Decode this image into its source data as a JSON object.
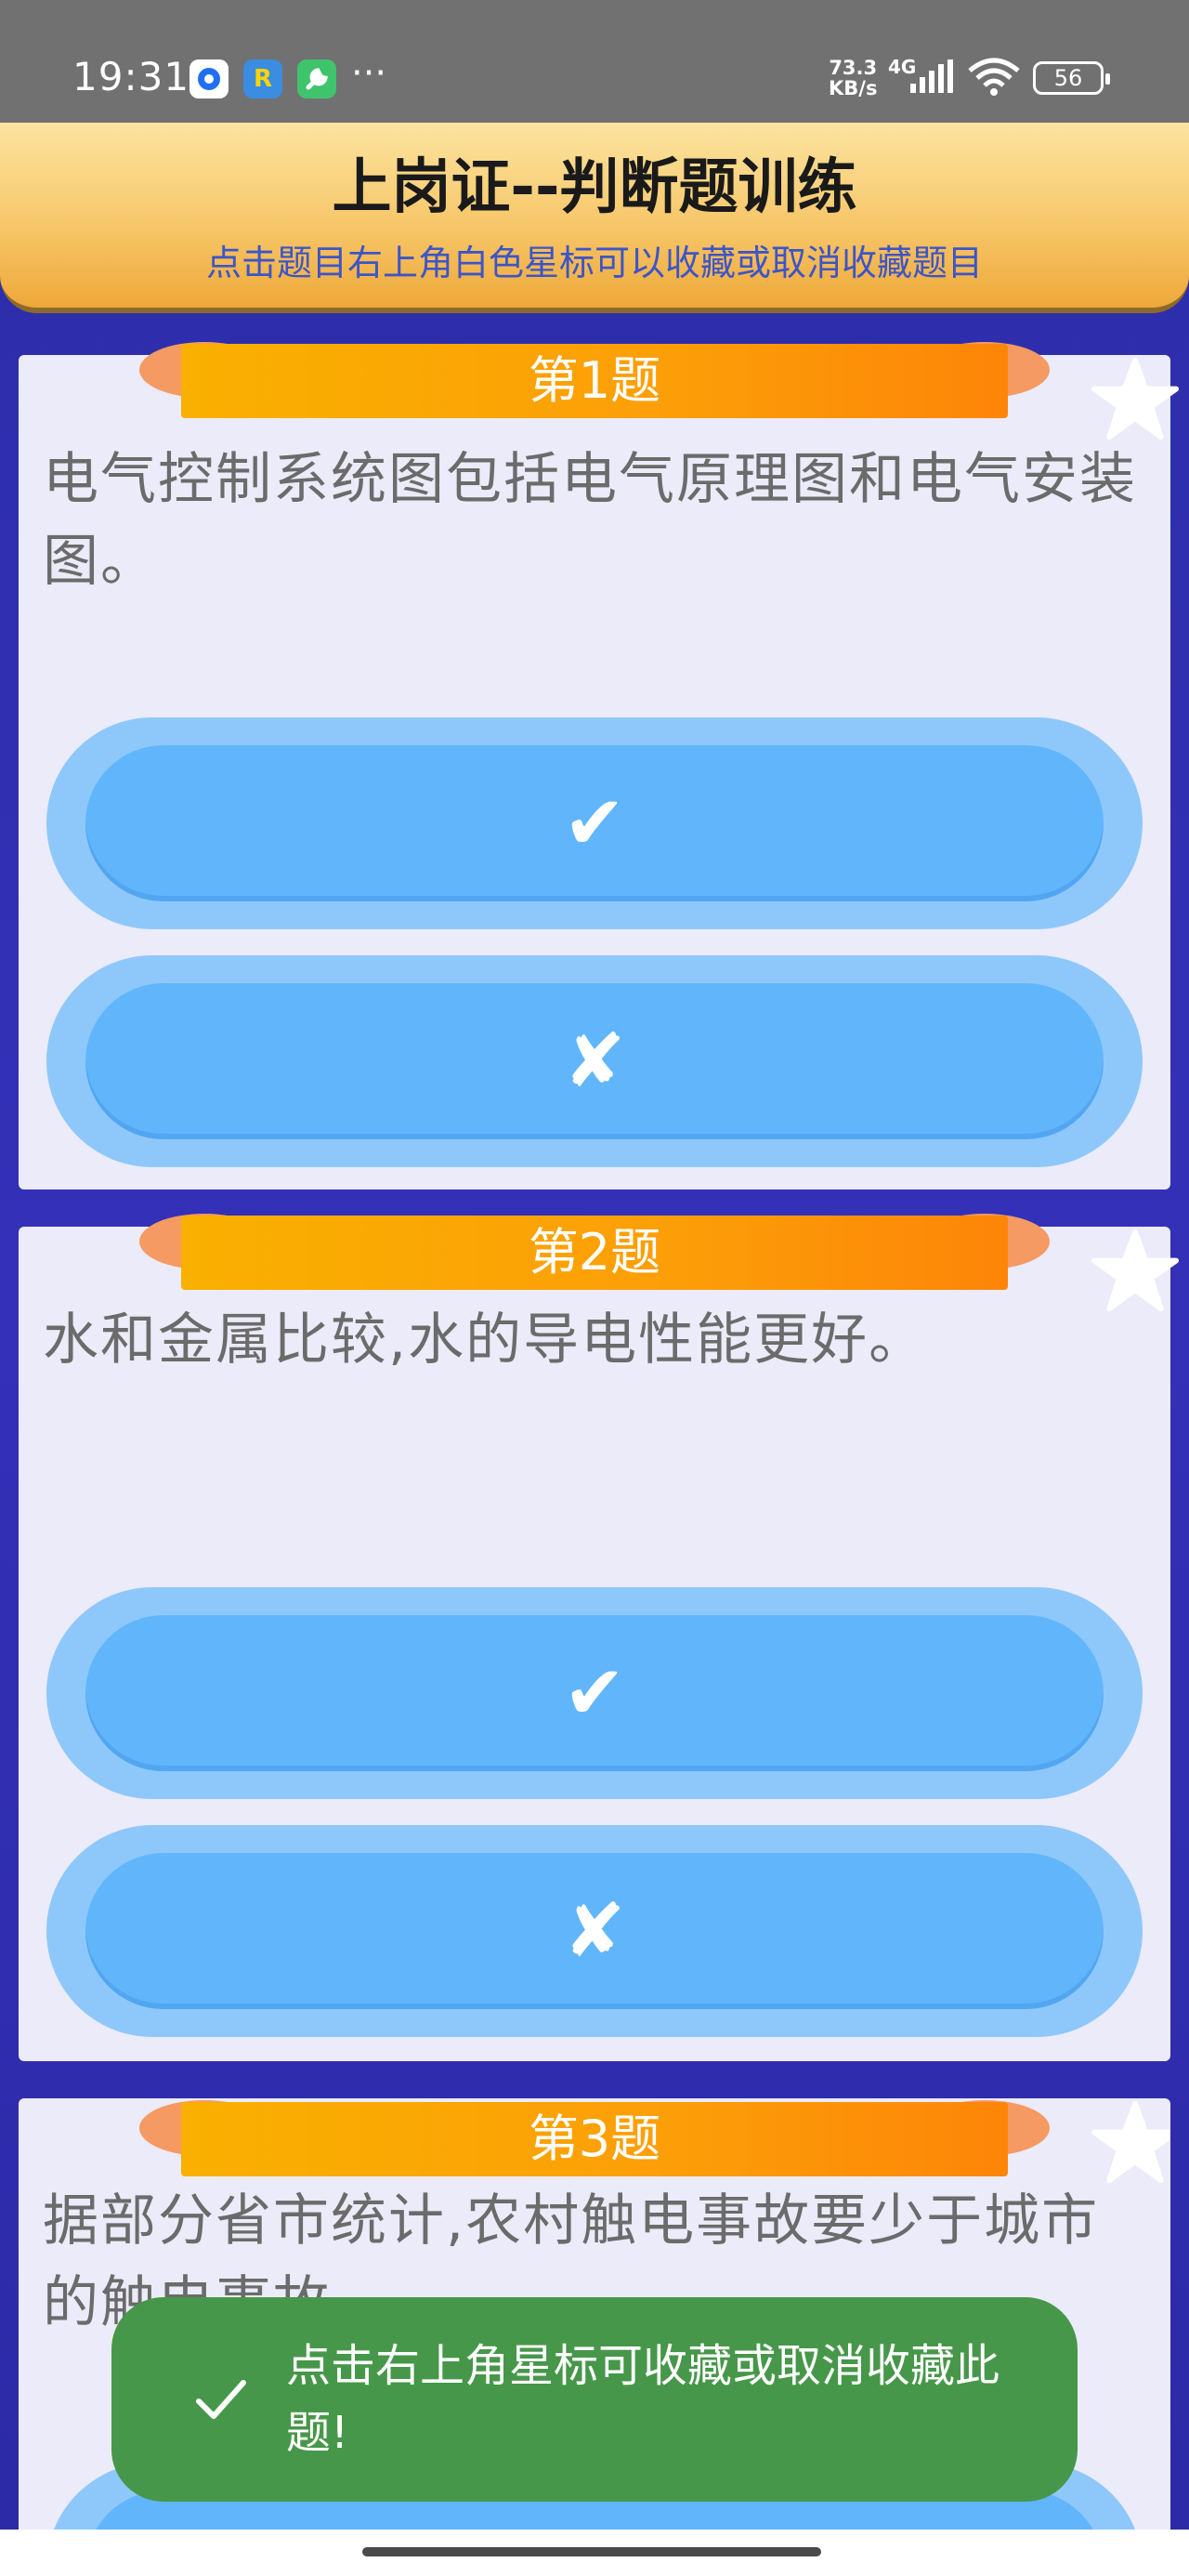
{
  "status_bar": {
    "time": "19:31",
    "app_icons": [
      {
        "icon": "circle-app-icon",
        "label": "",
        "color": "#1f6ff2"
      },
      {
        "icon": "r-app-icon",
        "label": "R",
        "color": "#3a8de0"
      },
      {
        "icon": "wrench-app-icon",
        "label": "",
        "color": "#3fc46b"
      }
    ],
    "more": "···",
    "net_speed_value": "73.3",
    "net_speed_unit": "KB/s",
    "network_type": "4G",
    "battery": "56"
  },
  "header": {
    "title": "上岗证--判断题训练",
    "subtitle": "点击题目右上角白色星标可以收藏或取消收藏题目"
  },
  "questions": [
    {
      "label": "第1题",
      "text": "电气控制系统图包括电气原理图和电气安装图。",
      "true_symbol": "✔",
      "false_symbol": "✘"
    },
    {
      "label": "第2题",
      "text": "水和金属比较,水的导电性能更好。",
      "true_symbol": "✔",
      "false_symbol": "✘"
    },
    {
      "label": "第3题",
      "text": "据部分省市统计,农村触电事故要少于城市的触电事故。",
      "true_symbol": "✔",
      "false_symbol": "✘"
    }
  ],
  "toast": {
    "text": "点击右上角星标可收藏或取消收藏此题!"
  },
  "colors": {
    "background": "#2f2fb0",
    "header": "#f7c76a",
    "ribbon": "#fd9a08",
    "answer_button": "#61b6fb",
    "toast": "#47974a"
  }
}
